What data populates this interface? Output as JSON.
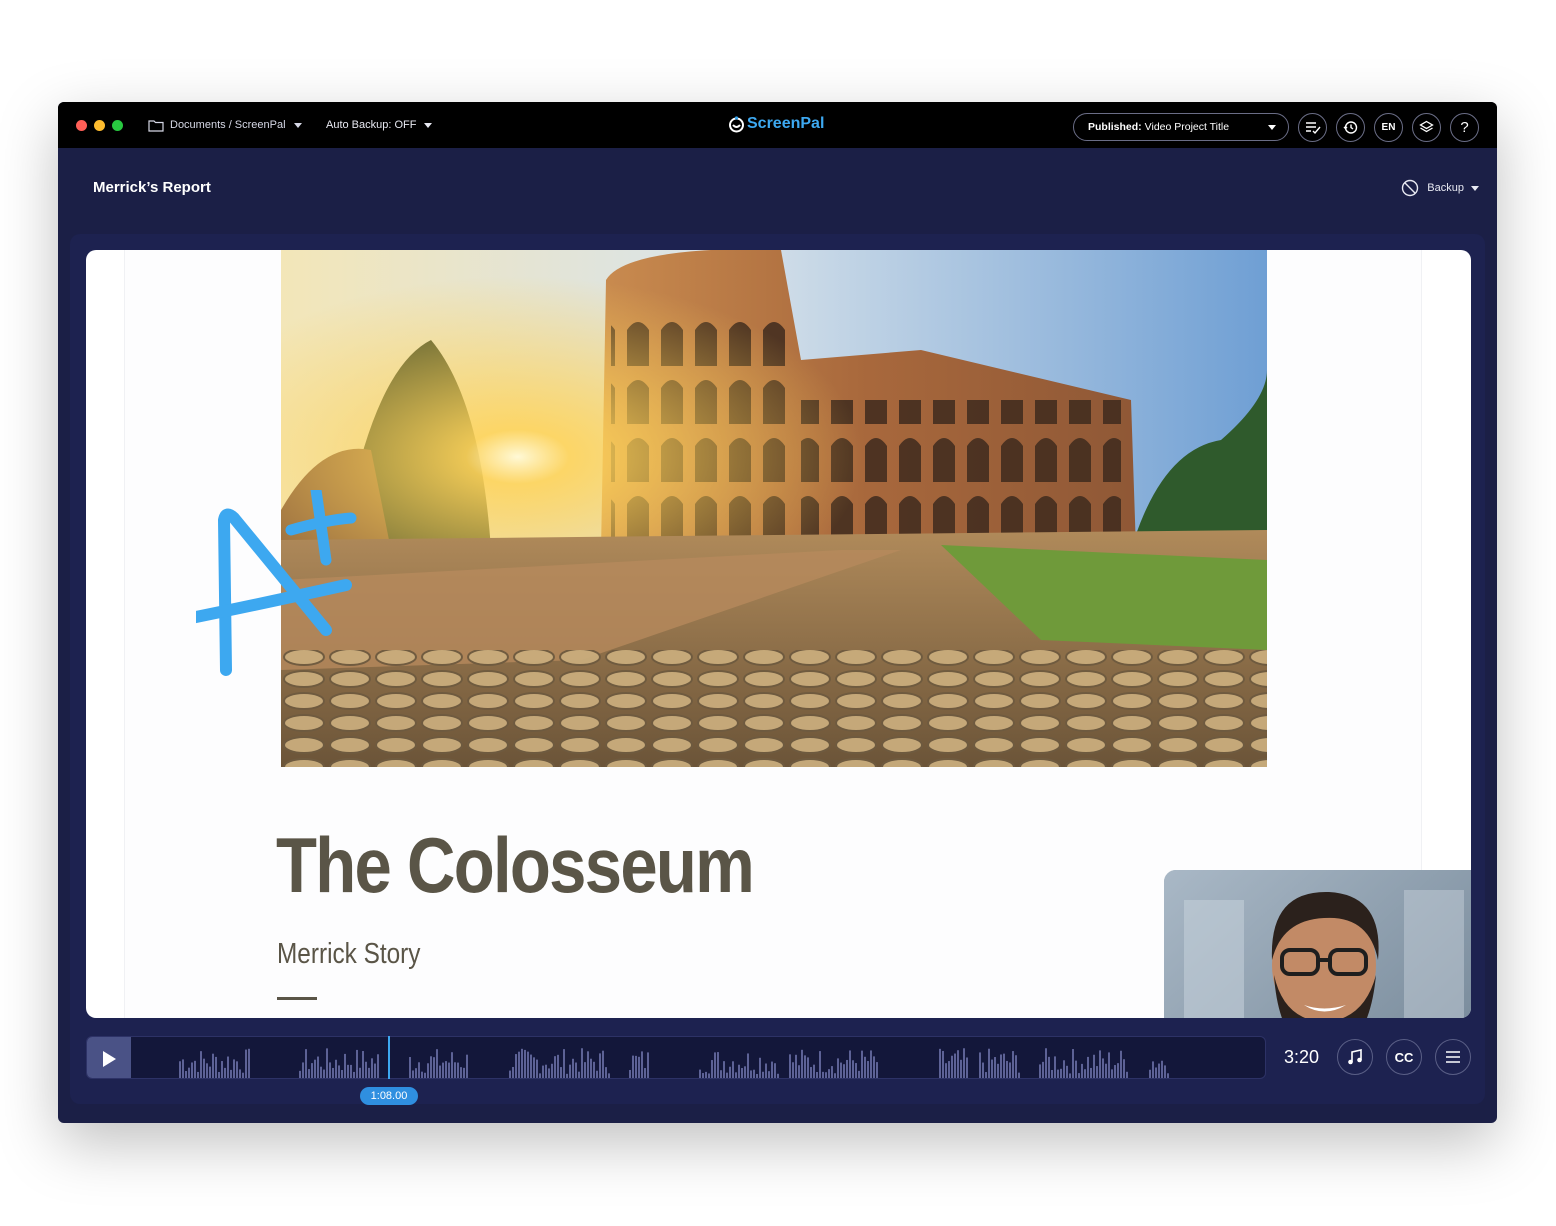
{
  "titlebar": {
    "path": "Documents / ScreenPal",
    "auto_backup": "Auto Backup: OFF",
    "logo": "ScreenPal",
    "publish_prefix": "Published:",
    "publish_title": "Video Project Title",
    "lang": "EN",
    "help": "?"
  },
  "header": {
    "title": "Merrick’s Report",
    "backup_label": "Backup"
  },
  "slide": {
    "title": "The Colosseum",
    "subtitle": "Merrick Story"
  },
  "player": {
    "playhead_time": "1:08.00",
    "duration": "3:20",
    "cc_label": "CC",
    "progress": 0.34
  },
  "colors": {
    "window_bg": "#1b1f46",
    "accent": "#3da8f0",
    "annotation": "#3da8f0"
  }
}
